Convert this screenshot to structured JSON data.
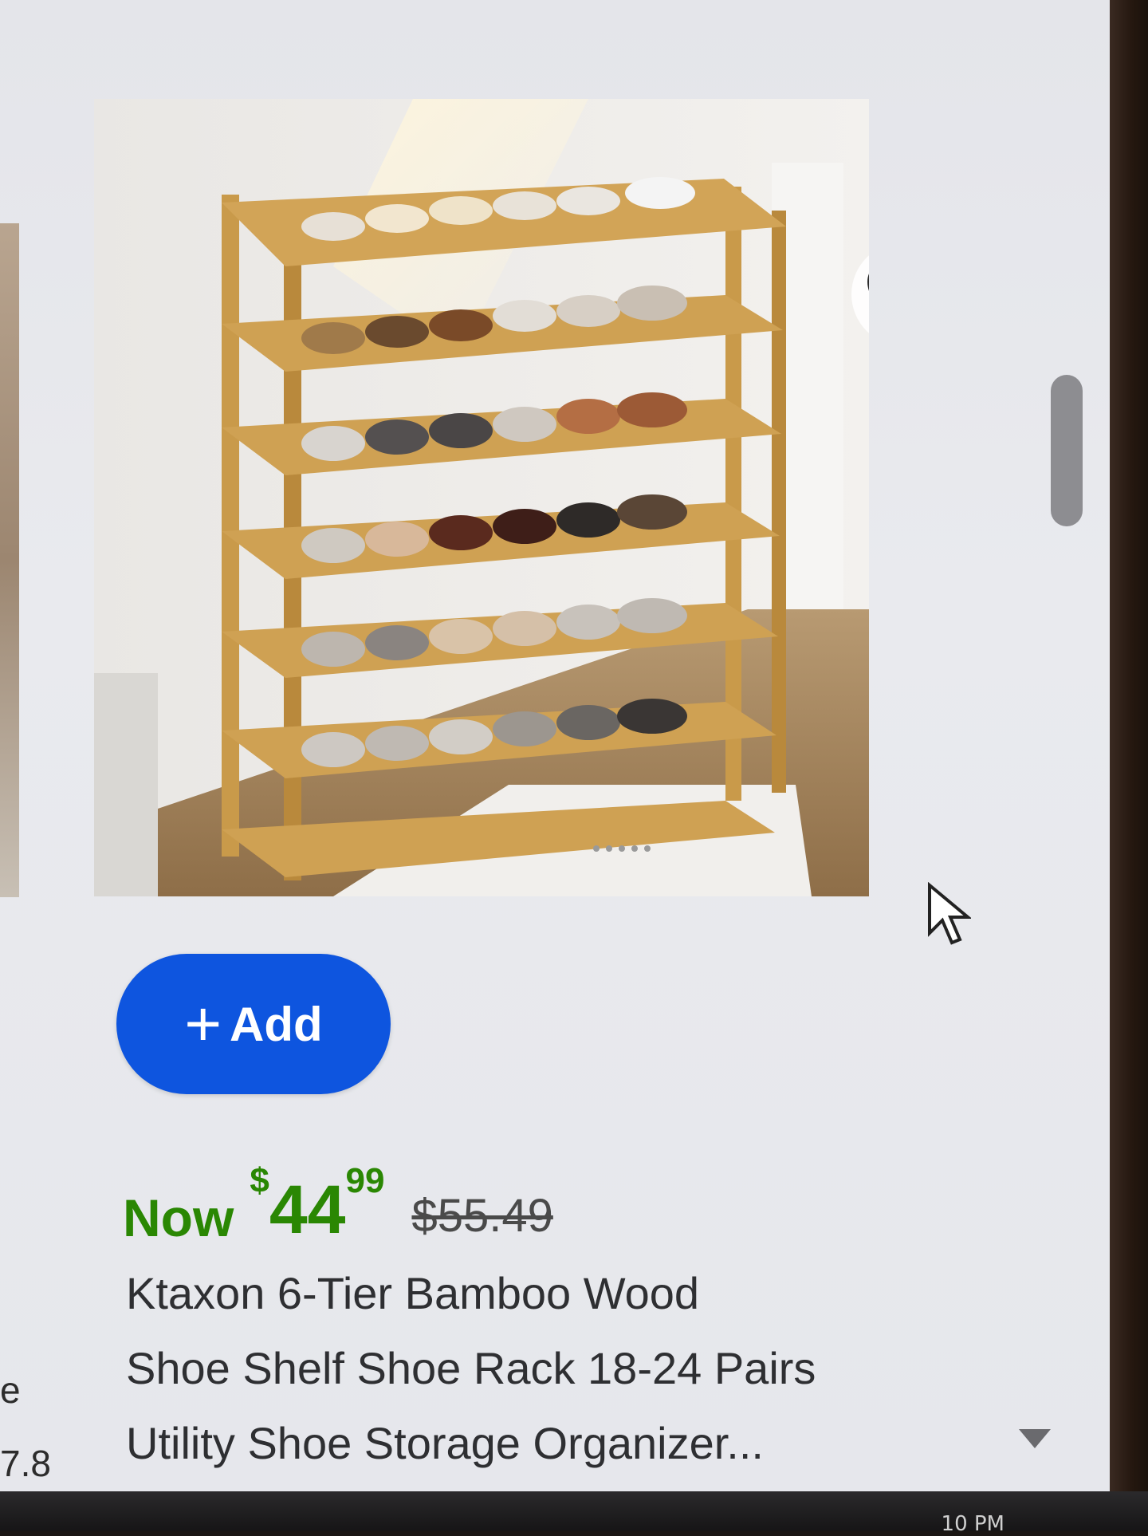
{
  "product": {
    "image_alt": "6-tier bamboo shoe rack with shoes",
    "favorite_icon": "heart-outline-icon",
    "add_button": {
      "icon": "plus-icon",
      "label": "Add"
    },
    "price": {
      "prefix": "Now",
      "currency": "$",
      "whole": "44",
      "cents": "99",
      "was": "$55.49"
    },
    "title_lines": [
      "Ktaxon 6-Tier Bamboo Wood",
      "Shoe Shelf Shoe Rack 18-24 Pairs",
      "Utility Shoe Storage Organizer..."
    ]
  },
  "left_card_partial": {
    "line1": "e",
    "line2": "7.8"
  },
  "colors": {
    "add_button": "#0e55df",
    "price_green": "#2a8703",
    "text": "#2e2f32",
    "wood": "#c99a4a"
  },
  "taskbar": {
    "time_partial": "10 PM"
  }
}
